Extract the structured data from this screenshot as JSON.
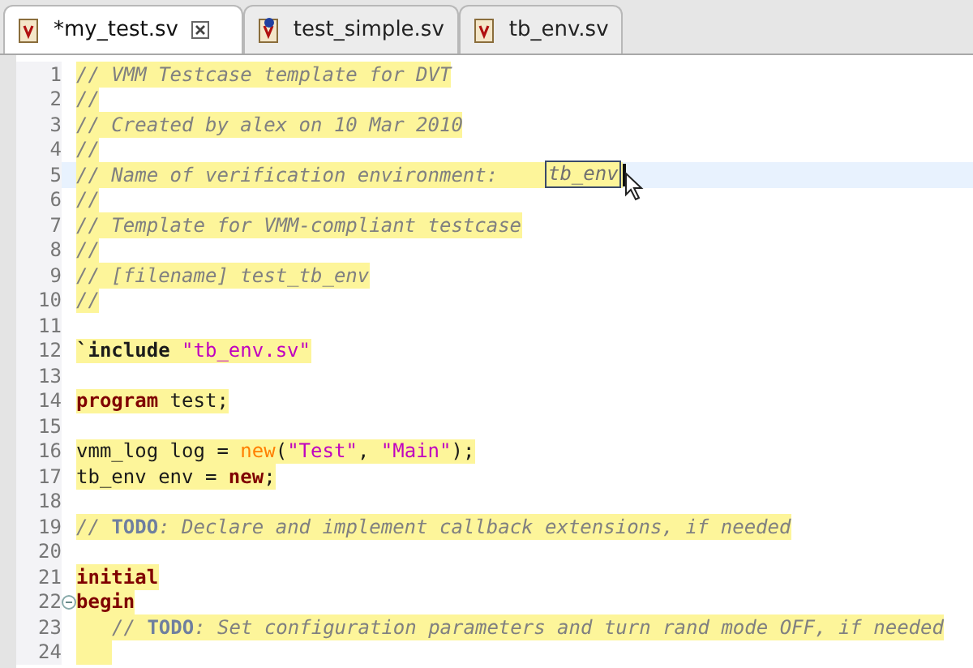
{
  "tabs": [
    {
      "label": "*my_test.sv",
      "selected": true,
      "pinned": false
    },
    {
      "label": "test_simple.sv",
      "selected": false,
      "pinned": true
    },
    {
      "label": "tb_env.sv",
      "selected": false,
      "pinned": false
    }
  ],
  "editor": {
    "lines": [
      {
        "number": "1",
        "highlighted": true,
        "current": false,
        "foldable": false,
        "indented": false,
        "segments": [
          {
            "kind": "comment",
            "text": "// VMM Testcase template for DVT"
          }
        ]
      },
      {
        "number": "2",
        "highlighted": true,
        "current": false,
        "foldable": false,
        "indented": false,
        "segments": [
          {
            "kind": "comment",
            "text": "//"
          }
        ]
      },
      {
        "number": "3",
        "highlighted": true,
        "current": false,
        "foldable": false,
        "indented": false,
        "segments": [
          {
            "kind": "comment",
            "text": "// Created by alex on 10 Mar 2010"
          }
        ]
      },
      {
        "number": "4",
        "highlighted": true,
        "current": false,
        "foldable": false,
        "indented": false,
        "segments": [
          {
            "kind": "comment",
            "text": "//"
          }
        ]
      },
      {
        "number": "5",
        "highlighted": true,
        "current": true,
        "foldable": false,
        "indented": false,
        "segments": [
          {
            "kind": "comment",
            "text": "// Name of verification environment:    "
          },
          {
            "kind": "field",
            "text": "tb_env"
          }
        ]
      },
      {
        "number": "6",
        "highlighted": true,
        "current": false,
        "foldable": false,
        "indented": false,
        "segments": [
          {
            "kind": "comment",
            "text": "//"
          }
        ]
      },
      {
        "number": "7",
        "highlighted": true,
        "current": false,
        "foldable": false,
        "indented": false,
        "segments": [
          {
            "kind": "comment",
            "text": "// Template for VMM-compliant testcase"
          }
        ]
      },
      {
        "number": "8",
        "highlighted": true,
        "current": false,
        "foldable": false,
        "indented": false,
        "segments": [
          {
            "kind": "comment",
            "text": "//"
          }
        ]
      },
      {
        "number": "9",
        "highlighted": true,
        "current": false,
        "foldable": false,
        "indented": false,
        "segments": [
          {
            "kind": "comment",
            "text": "// [filename] test_tb_env"
          }
        ]
      },
      {
        "number": "10",
        "highlighted": true,
        "current": false,
        "foldable": false,
        "indented": false,
        "segments": [
          {
            "kind": "comment",
            "text": "//"
          }
        ]
      },
      {
        "number": "11",
        "highlighted": false,
        "current": false,
        "foldable": false,
        "indented": false
      },
      {
        "number": "12",
        "highlighted": true,
        "current": false,
        "foldable": false,
        "indented": false,
        "segments": [
          {
            "kind": "directive",
            "text": "`include"
          },
          {
            "kind": "string",
            "text": " \"tb_env.sv\""
          }
        ]
      },
      {
        "number": "13",
        "highlighted": false,
        "current": false,
        "foldable": false,
        "indented": false
      },
      {
        "number": "14",
        "highlighted": true,
        "current": false,
        "foldable": false,
        "indented": false,
        "segments": [
          {
            "kind": "keyword",
            "text": "program"
          },
          {
            "kind": "plain",
            "text": " test;"
          }
        ]
      },
      {
        "number": "15",
        "highlighted": false,
        "current": false,
        "foldable": false,
        "indented": false
      },
      {
        "number": "16",
        "highlighted": true,
        "current": false,
        "foldable": false,
        "indented": false,
        "segments": [
          {
            "kind": "plain",
            "text": "vmm_log log = "
          },
          {
            "kind": "call",
            "text": "new"
          },
          {
            "kind": "plain",
            "text": "("
          },
          {
            "kind": "string",
            "text": "\"Test\""
          },
          {
            "kind": "plain",
            "text": ", "
          },
          {
            "kind": "string",
            "text": "\"Main\""
          },
          {
            "kind": "plain",
            "text": ");"
          }
        ]
      },
      {
        "number": "17",
        "highlighted": true,
        "current": false,
        "foldable": false,
        "indented": false,
        "segments": [
          {
            "kind": "plain",
            "text": "tb_env env = "
          },
          {
            "kind": "keyword",
            "text": "new"
          },
          {
            "kind": "plain",
            "text": ";"
          }
        ]
      },
      {
        "number": "18",
        "highlighted": false,
        "current": false,
        "foldable": false,
        "indented": false
      },
      {
        "number": "19",
        "highlighted": true,
        "current": false,
        "foldable": false,
        "indented": false,
        "segments": [
          {
            "kind": "comment",
            "text": "// "
          },
          {
            "kind": "todo",
            "text": "TODO"
          },
          {
            "kind": "comment",
            "text": ": Declare and implement callback extensions, if needed"
          }
        ]
      },
      {
        "number": "20",
        "highlighted": false,
        "current": false,
        "foldable": false,
        "indented": false
      },
      {
        "number": "21",
        "highlighted": true,
        "current": false,
        "foldable": false,
        "indented": false,
        "segments": [
          {
            "kind": "keyword",
            "text": "initial"
          }
        ]
      },
      {
        "number": "22",
        "highlighted": true,
        "current": false,
        "foldable": true,
        "indented": false,
        "segments": [
          {
            "kind": "keyword",
            "text": "begin"
          }
        ]
      },
      {
        "number": "23",
        "highlighted": true,
        "current": false,
        "foldable": false,
        "indented": true,
        "segments": [
          {
            "kind": "comment",
            "text": "// "
          },
          {
            "kind": "todo",
            "text": "TODO"
          },
          {
            "kind": "comment",
            "text": ": Set configuration parameters and turn rand mode OFF, if needed"
          }
        ]
      },
      {
        "number": "24",
        "highlighted": true,
        "current": false,
        "foldable": false,
        "indented": true
      }
    ]
  }
}
